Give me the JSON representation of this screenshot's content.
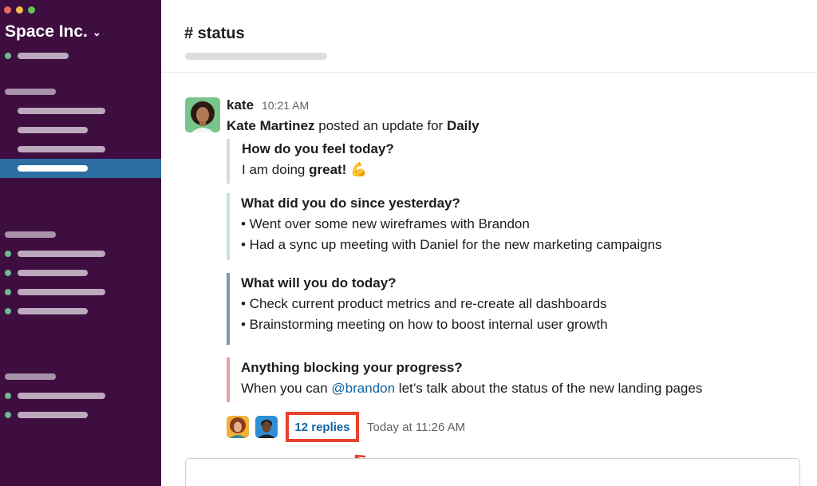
{
  "workspace": {
    "name": "Space Inc.",
    "chevron": "⌄"
  },
  "colors": {
    "sidebar": "#3f0e40",
    "selected": "#2e6ca4",
    "link": "#1264a3",
    "highlight": "#e8412c",
    "online": "#6fb98f"
  },
  "channel": {
    "title": "# status"
  },
  "message": {
    "author": "kate",
    "time": "10:21 AM",
    "posted_prefix": "Kate Martinez",
    "posted_middle": " posted an update for ",
    "posted_target": "Daily",
    "blocks": [
      {
        "question": "How do you feel today?",
        "answer_prefix": "I am doing ",
        "answer_bold": "great!",
        "emoji": "💪"
      },
      {
        "question": "What did you do since yesterday?",
        "lines": [
          "• Went over some new wireframes with Brandon",
          "• Had a sync up meeting with Daniel for the new marketing campaigns"
        ]
      },
      {
        "question": "What will you do today?",
        "lines": [
          "• Check current product metrics and re-create all dashboards",
          "• Brainstorming meeting on how to boost internal user growth"
        ]
      },
      {
        "question": "Anything blocking your progress?",
        "answer_prefix": "When you can ",
        "mention": "@brandon",
        "answer_suffix": " let’s talk about the status of the new landing pages"
      }
    ],
    "thread": {
      "replies": "12 replies",
      "last_reply": "Today at 11:26 AM"
    }
  }
}
